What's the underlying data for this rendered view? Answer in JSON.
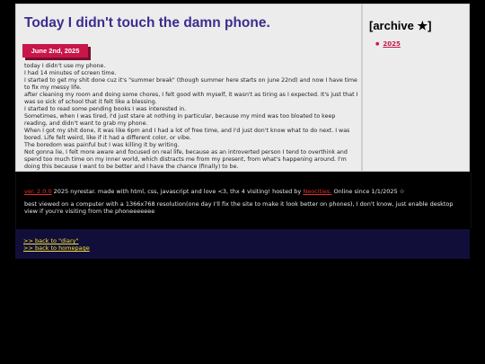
{
  "post": {
    "title": "Today I didn't touch the damn phone.",
    "date": "June 2nd, 2025",
    "paragraphs": [
      "today I didn't use my phone.",
      "I had 14 minutes of screen time.",
      "I started to get my shit done cuz it's \"summer break\" (though summer here starts on june 22nd) and now I have time to fix my messy life.",
      "after cleaning my room and doing some chores, I felt good with myself, it wasn't as tiring as I expected. It's just that I was so sick of school that it felt like a blessing.",
      "I started to read some pending books I was interested in.",
      "Sometimes, when I was tired, I'd just stare at nothing in particular, because my mind was too bloated to keep reading, and didn't want to grab my phone.",
      "When I got my shit done, it was like 6pm and I had a lot of free time, and I'd just don't know what to do next. I was bored. Life felt weird, like if it had a different color, or vibe.",
      "The boredom was painful but I was killing it by writing.",
      "Not gonna lie, I felt more aware and focused on real life, because as an introverted person I tend to overthink and spend too much time on my inner world, which distracts me from my present, from what's happening around. I'm doing this because I want to be better and I have the chance (finally) to be."
    ]
  },
  "sidebar": {
    "title": "[archive ★]",
    "items": [
      {
        "label": "2025"
      }
    ]
  },
  "footer": {
    "version_link": "ver. 2.0.0",
    "line1_mid": "2025 nyrestar. made with html, css, javascript and love <3, thx 4 visiting! hosted by ",
    "host_link": "Neocities.",
    "line1_end": " Online since 1/1/2025 ☆",
    "line2": "best viewed on a computer with a 1366x768 resolution(one day I'll fix the site to make it look better on phones), I don't know, just enable desktop view if you're visiting from the phoneeeeeee"
  },
  "nav": {
    "back_diary": ">> back to \"diary\"",
    "back_home": ">> back to homepage"
  },
  "colors": {
    "background": "#000000",
    "panel": "#ececec",
    "title": "#3b2d8e",
    "accent": "#c8164a",
    "nav_bg": "#110f3a",
    "nav_link": "#f2e033",
    "footer_link": "#e0302e"
  }
}
